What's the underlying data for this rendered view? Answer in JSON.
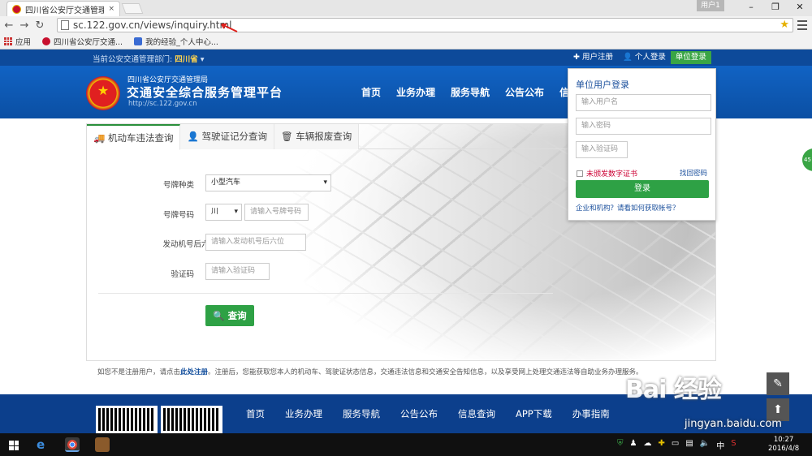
{
  "browser": {
    "tab_title": "四川省公安厅交通管理局",
    "tab_close": "×",
    "user_badge": "用户1",
    "url": "sc.122.gov.cn/views/inquiry.html",
    "bookmarks": [
      "应用",
      "四川省公安厅交通...",
      "我的经验_个人中心..."
    ]
  },
  "topstrip": {
    "dept_prefix": "当前公安交通管理部门:",
    "dept_value": "四川省",
    "links": [
      "✚ 用户注册",
      "👤 个人登录",
      "单位登录"
    ]
  },
  "header": {
    "org": "四川省公安厅交通管理局",
    "platform": "交通安全综合服务管理平台",
    "site": "http://sc.122.gov.cn",
    "nav": [
      "首页",
      "业务办理",
      "服务导航",
      "公告公布",
      "信"
    ]
  },
  "query": {
    "tabs": [
      "🚚 机动车违法查询",
      "👤 驾驶证记分查询",
      "🗑 车辆报废查询"
    ],
    "labels": {
      "plate_type": "号牌种类",
      "plate_no": "号牌号码",
      "engine": "发动机号后六位",
      "captcha": "验证码"
    },
    "plate_type_value": "小型汽车",
    "province_value": "川",
    "placeholders": {
      "plate_no": "请输入号牌号码",
      "engine": "请输入发动机号后六位",
      "captcha": "请输入验证码"
    },
    "submit": "查询"
  },
  "note": {
    "prefix": "如您不是注册用户，请点击",
    "link": "此处注册",
    "suffix": "。注册后，您能获取您本人的机动车、驾驶证状态信息，交通违法信息和交通安全告知信息，以及享受网上处理交通违法等自助业务办理服务。"
  },
  "footer_nav": [
    "首页",
    "业务办理",
    "服务导航",
    "公告公布",
    "信息查询",
    "APP下载",
    "办事指南"
  ],
  "login": {
    "title": "单位用户登录",
    "username_ph": "输入用户名",
    "password_ph": "输入密码",
    "captcha_ph": "输入验证码",
    "cert": "未颁发数字证书",
    "find": "找回密码",
    "submit": "登录",
    "help": "企业和机构？请看如何获取帐号？"
  },
  "side": {
    "pill": "45"
  },
  "watermark": {
    "big": "Bai 经验",
    "small": "jingyan.baidu.com"
  },
  "taskbar": {
    "ime": "中",
    "time": "10:27",
    "date": "2016/4/8"
  }
}
